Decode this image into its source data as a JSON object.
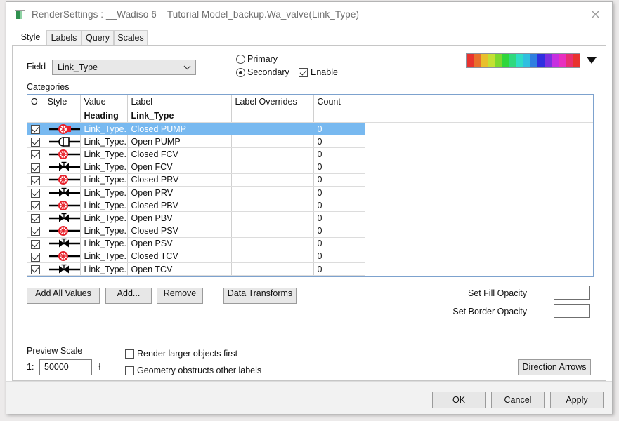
{
  "window": {
    "title": "RenderSettings : __Wadiso 6 – Tutorial Model_backup.Wa_valve(Link_Type)",
    "icon": "image-layer-icon",
    "close_label": "close-icon"
  },
  "tabs": [
    {
      "label": "Style",
      "active": true
    },
    {
      "label": "Labels",
      "active": false
    },
    {
      "label": "Query",
      "active": false
    },
    {
      "label": "Scales",
      "active": false
    }
  ],
  "style_tab": {
    "field_label": "Field",
    "field_value": "Link_Type",
    "radios": [
      {
        "label": "Primary",
        "selected": false
      },
      {
        "label": "Secondary",
        "selected": true
      }
    ],
    "enable_checkbox": {
      "label": "Enable",
      "checked": true
    },
    "ramp_colors": [
      "#e8332f",
      "#e8702c",
      "#e8bf2c",
      "#c3e033",
      "#7cd92e",
      "#2fd63b",
      "#2fd97e",
      "#2fdcc6",
      "#2fbfe0",
      "#2f7fe0",
      "#2f2fe0",
      "#7c2fe0",
      "#c62fe0",
      "#e82fbf",
      "#e82f70",
      "#e8332f"
    ],
    "ramp_dropdown_icon": "chevron-down-icon",
    "categories_label": "Categories",
    "table": {
      "columns": [
        "O",
        "Style",
        "Value",
        "Label",
        "Label Overrides",
        "Count"
      ],
      "heading_row": {
        "value": "Heading",
        "label": "Link_Type"
      },
      "rows": [
        {
          "checked": true,
          "symbol": "closed-pump",
          "value": "Link_Type...",
          "label": "Closed PUMP",
          "overrides": "",
          "count": "0",
          "selected": true
        },
        {
          "checked": true,
          "symbol": "open-pump",
          "value": "Link_Type...",
          "label": "Open PUMP",
          "overrides": "",
          "count": "0",
          "selected": false
        },
        {
          "checked": true,
          "symbol": "closed-valve",
          "value": "Link_Type...",
          "label": "Closed FCV",
          "overrides": "",
          "count": "0",
          "selected": false
        },
        {
          "checked": true,
          "symbol": "open-valve",
          "value": "Link_Type...",
          "label": "Open FCV",
          "overrides": "",
          "count": "0",
          "selected": false
        },
        {
          "checked": true,
          "symbol": "closed-valve",
          "value": "Link_Type...",
          "label": "Closed PRV",
          "overrides": "",
          "count": "0",
          "selected": false
        },
        {
          "checked": true,
          "symbol": "open-valve",
          "value": "Link_Type...",
          "label": "Open PRV",
          "overrides": "",
          "count": "0",
          "selected": false
        },
        {
          "checked": true,
          "symbol": "closed-valve",
          "value": "Link_Type...",
          "label": "Closed PBV",
          "overrides": "",
          "count": "0",
          "selected": false
        },
        {
          "checked": true,
          "symbol": "open-valve",
          "value": "Link_Type...",
          "label": "Open PBV",
          "overrides": "",
          "count": "0",
          "selected": false
        },
        {
          "checked": true,
          "symbol": "closed-valve",
          "value": "Link_Type...",
          "label": "Closed PSV",
          "overrides": "",
          "count": "0",
          "selected": false
        },
        {
          "checked": true,
          "symbol": "open-valve",
          "value": "Link_Type...",
          "label": "Open PSV",
          "overrides": "",
          "count": "0",
          "selected": false
        },
        {
          "checked": true,
          "symbol": "closed-valve",
          "value": "Link_Type...",
          "label": "Closed TCV",
          "overrides": "",
          "count": "0",
          "selected": false
        },
        {
          "checked": true,
          "symbol": "open-valve",
          "value": "Link_Type...",
          "label": "Open TCV",
          "overrides": "",
          "count": "0",
          "selected": false
        }
      ]
    },
    "buttons": {
      "add_all_values": "Add All Values",
      "add": "Add...",
      "remove": "Remove",
      "data_transforms": "Data Transforms",
      "direction_arrows": "Direction Arrows"
    },
    "opacity": {
      "fill_label": "Set Fill Opacity",
      "fill_value": "",
      "border_label": "Set Border Opacity",
      "border_value": ""
    },
    "preview_scale": {
      "title": "Preview Scale",
      "prefix": "1:",
      "value": "50000",
      "lock_icon": "scale-lock-icon"
    },
    "render_options": [
      {
        "label": "Render larger objects first",
        "checked": false
      },
      {
        "label": "Geometry obstructs other labels",
        "checked": false
      }
    ]
  },
  "footer_buttons": {
    "ok": "OK",
    "cancel": "Cancel",
    "apply": "Apply"
  }
}
